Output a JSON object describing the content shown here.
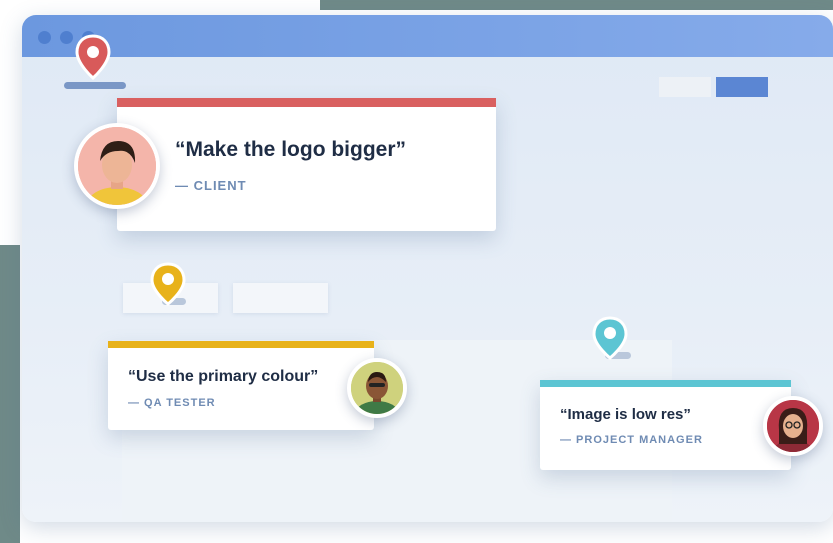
{
  "colors": {
    "titlebar": "#7aa2e6",
    "pin_red": "#d85a5a",
    "pin_yellow": "#e8b21a",
    "pin_cyan": "#5cc5d3",
    "accent_blue": "#5b86d3"
  },
  "comments": [
    {
      "quote": "“Make the logo bigger”",
      "author": "— CLIENT",
      "accent": "#d96060",
      "icon": "map-pin-icon"
    },
    {
      "quote": "“Use the primary colour”",
      "author": "— QA TESTER",
      "accent": "#e8b21a",
      "icon": "map-pin-icon"
    },
    {
      "quote": "“Image is low res”",
      "author": "— PROJECT MANAGER",
      "accent": "#5cc5d3",
      "icon": "map-pin-icon"
    }
  ]
}
